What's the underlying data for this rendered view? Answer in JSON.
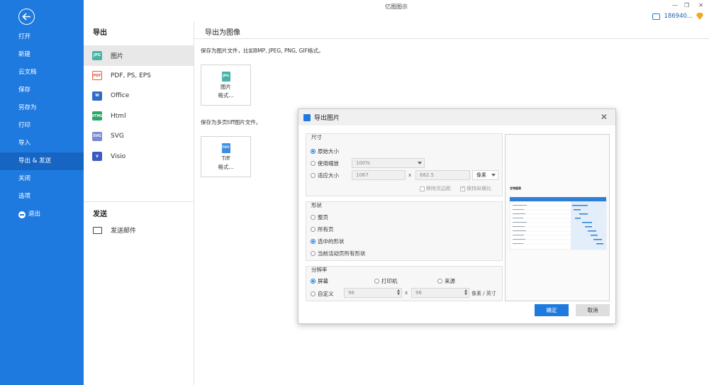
{
  "app": {
    "title": "亿图图示"
  },
  "user": {
    "id": "186940..."
  },
  "sidebar": {
    "items": [
      {
        "label": "打开"
      },
      {
        "label": "新建"
      },
      {
        "label": "云文档"
      },
      {
        "label": "保存"
      },
      {
        "label": "另存为"
      },
      {
        "label": "打印"
      },
      {
        "label": "导入"
      },
      {
        "label": "导出 & 发送",
        "active": true
      },
      {
        "label": "关闭"
      },
      {
        "label": "选项"
      },
      {
        "label": "退出"
      }
    ]
  },
  "middle": {
    "export_heading": "导出",
    "items": [
      {
        "label": "图片",
        "icon": "jpg-file-icon",
        "badge": "JPG"
      },
      {
        "label": "PDF, PS, EPS",
        "icon": "pdf-file-icon",
        "badge": "PDF"
      },
      {
        "label": "Office",
        "icon": "word-file-icon",
        "badge": "W"
      },
      {
        "label": "Html",
        "icon": "html-file-icon",
        "badge": "HTML"
      },
      {
        "label": "SVG",
        "icon": "svg-file-icon",
        "badge": "SVG"
      },
      {
        "label": "Visio",
        "icon": "visio-file-icon",
        "badge": "V"
      }
    ],
    "send_heading": "发送",
    "send_item": "发送邮件"
  },
  "content": {
    "heading": "导出为图像",
    "desc1": "保存为图片文件，比如BMP, JPEG, PNG, GIF格式。",
    "tile1": {
      "line1": "图片",
      "line2": "格式...",
      "badge": "JPG"
    },
    "desc2": "保存为多页tiff图片文件。",
    "tile2": {
      "line1": "Tiff",
      "line2": "格式...",
      "badge": "TIFF"
    }
  },
  "dialog": {
    "title": "导出图片",
    "size": {
      "title": "尺寸",
      "opt_original": "原始大小",
      "opt_zoom": "使用缩放",
      "zoom_value": "100%",
      "opt_fit": "适应大小",
      "width": "1067",
      "x": "x",
      "height": "682.5",
      "unit": "像素",
      "remove_margin": "移除页边距",
      "keep_ratio": "保持纵横比"
    },
    "shape": {
      "title": "形状",
      "opt_whole": "整页",
      "opt_all": "所有页",
      "opt_selected": "选中的形状",
      "opt_current_all": "当前活动页所有形状"
    },
    "resolution": {
      "title": "分辨率",
      "opt_screen": "屏幕",
      "opt_printer": "打印机",
      "opt_source": "来源",
      "opt_custom": "自定义",
      "dpi_x": "96",
      "x": "x",
      "dpi_y": "96",
      "unit": "像素 / 英寸"
    },
    "preview_title": "甘特图表",
    "ok": "确定",
    "cancel": "取消"
  }
}
